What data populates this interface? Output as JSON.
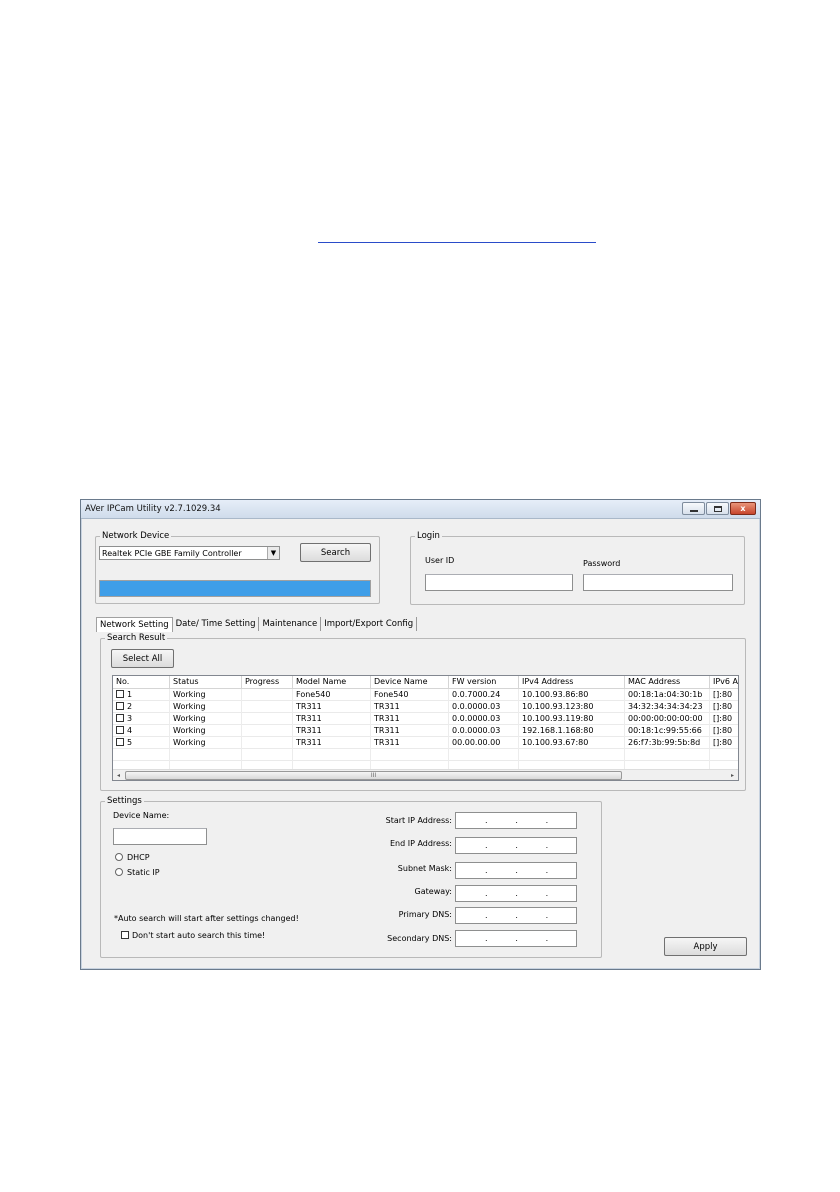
{
  "window": {
    "title": "AVer IPCam Utility v2.7.1029.34",
    "minimize": "–",
    "maximize": "□",
    "close": "x"
  },
  "network_device": {
    "legend": "Network Device",
    "selected": "Realtek PCIe GBE Family Controller",
    "search_label": "Search",
    "progress": 1.0
  },
  "login": {
    "legend": "Login",
    "user_id_label": "User ID",
    "password_label": "Password",
    "user_id_value": "",
    "password_value": ""
  },
  "tabs": [
    "Network Setting",
    "Date/ Time Setting",
    "Maintenance",
    "Import/Export Config"
  ],
  "search_result": {
    "legend": "Search Result",
    "select_all_label": "Select All",
    "columns": [
      "No.",
      "Status",
      "Progress",
      "Model Name",
      "Device Name",
      "FW version",
      "IPv4 Address",
      "MAC Address",
      "IPv6 A"
    ],
    "rows": [
      [
        "1",
        "Working",
        "",
        "Fone540",
        "Fone540",
        "0.0.7000.24",
        "10.100.93.86:80",
        "00:18:1a:04:30:1b",
        "[]:80"
      ],
      [
        "2",
        "Working",
        "",
        "TR311",
        "TR311",
        "0.0.0000.03",
        "10.100.93.123:80",
        "34:32:34:34:34:23",
        "[]:80"
      ],
      [
        "3",
        "Working",
        "",
        "TR311",
        "TR311",
        "0.0.0000.03",
        "10.100.93.119:80",
        "00:00:00:00:00:00",
        "[]:80"
      ],
      [
        "4",
        "Working",
        "",
        "TR311",
        "TR311",
        "0.0.0000.03",
        "192.168.1.168:80",
        "00:18:1c:99:55:66",
        "[]:80"
      ],
      [
        "5",
        "Working",
        "",
        "TR311",
        "TR311",
        "00.00.00.00",
        "10.100.93.67:80",
        "26:f7:3b:99:5b:8d",
        "[]:80"
      ]
    ],
    "scroll_left": "◂",
    "scroll_right": "▸",
    "scroll_grip": "III"
  },
  "settings": {
    "legend": "Settings",
    "device_name_label": "Device Name:",
    "device_name_value": "",
    "dhcp_label": "DHCP",
    "static_ip_label": "Static IP",
    "note": "*Auto search will start after settings changed!",
    "dont_search_label": "Don't start auto search this time!",
    "start_ip_label": "Start IP Address:",
    "end_ip_label": "End IP Address:",
    "subnet_label": "Subnet Mask:",
    "gateway_label": "Gateway:",
    "primary_dns_label": "Primary DNS:",
    "secondary_dns_label": "Secondary DNS:",
    "ip_dots": "."
  },
  "apply_label": "Apply"
}
